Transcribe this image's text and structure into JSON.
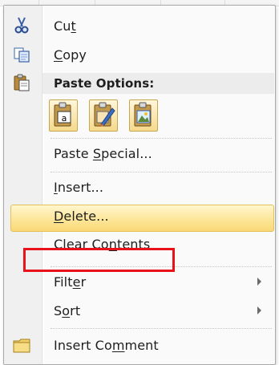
{
  "menu": {
    "items": [
      {
        "id": "cut",
        "pre": "Cu",
        "key": "t",
        "post": "",
        "icon": "scissors-icon"
      },
      {
        "id": "copy",
        "pre": "",
        "key": "C",
        "post": "opy",
        "icon": "copy-icon"
      },
      {
        "id": "paste-options",
        "label": "Paste Options:",
        "icon": "paste-clipboard-icon"
      },
      {
        "id": "paste-special",
        "pre": "Paste ",
        "key": "S",
        "post": "pecial...",
        "icon": ""
      },
      {
        "id": "insert",
        "pre": "",
        "key": "I",
        "post": "nsert...",
        "icon": ""
      },
      {
        "id": "delete",
        "pre": "",
        "key": "D",
        "post": "elete...",
        "icon": ""
      },
      {
        "id": "clear-contents",
        "pre": "Clear Co",
        "key": "n",
        "post": "tents",
        "icon": ""
      },
      {
        "id": "filter",
        "pre": "Filt",
        "key": "e",
        "post": "r",
        "icon": ""
      },
      {
        "id": "sort",
        "pre": "S",
        "key": "o",
        "post": "rt",
        "icon": ""
      },
      {
        "id": "insert-comment",
        "pre": "Insert Co",
        "key": "m",
        "post": "ment",
        "icon": "comment-icon"
      }
    ],
    "paste_buttons": [
      "paste-values-icon",
      "paste-formatting-icon",
      "paste-picture-icon"
    ]
  },
  "colors": {
    "hover_fill": "#fde699",
    "hover_border": "#e3c05a",
    "callout": "#e8121a"
  }
}
